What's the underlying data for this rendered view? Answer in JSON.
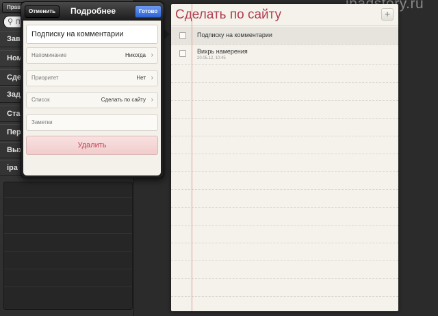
{
  "watermark": "ipadstory.ru",
  "sidebar": {
    "edit_label": "Прав",
    "search_placeholder": "П",
    "items": [
      {
        "label": "Зав"
      },
      {
        "label": "Ном"
      },
      {
        "label": "Сде"
      },
      {
        "label": "Зад"
      },
      {
        "label": "Ста"
      },
      {
        "label": "Пер"
      },
      {
        "label": "Вых"
      },
      {
        "label": "ipa"
      }
    ]
  },
  "popover": {
    "cancel_label": "Отменить",
    "title": "Подробнее",
    "done_label": "Готово",
    "task_title": "Подписку на комментарии",
    "rows": [
      {
        "label": "Напоминание",
        "value": "Никогда"
      },
      {
        "label": "Приоритет",
        "value": "Нет"
      },
      {
        "label": "Список",
        "value": "Сделать по сайту"
      }
    ],
    "notes_placeholder": "Заметки",
    "delete_label": "Удалить"
  },
  "notepad": {
    "title": "Сделать по сайту",
    "add_label": "+",
    "tasks": [
      {
        "title": "Подписку на комментарии",
        "subtitle": ""
      },
      {
        "title": "Вихрь намерения",
        "subtitle": "20.05.12, 10:45"
      }
    ]
  },
  "icons": {
    "search": "search-icon",
    "chevron": "chevron-right-icon",
    "add": "plus-icon"
  }
}
